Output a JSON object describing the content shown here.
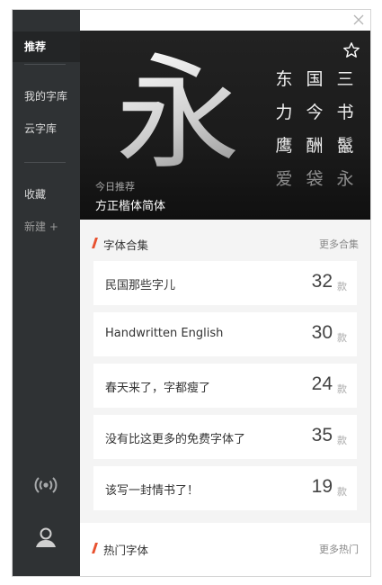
{
  "sidebar": {
    "items": [
      {
        "label": "推荐"
      },
      {
        "label": "我的字库"
      },
      {
        "label": "云字库"
      },
      {
        "label": "收藏"
      },
      {
        "label": "新建 +"
      }
    ],
    "icons": {
      "broadcast": "broadcast-icon",
      "user": "user-icon"
    }
  },
  "banner": {
    "big_glyph": "永",
    "chars": [
      "东",
      "国",
      "三",
      "力",
      "今",
      "书",
      "鹰",
      "酬",
      "鬣",
      "爱",
      "袋",
      "永"
    ],
    "today_label": "今日推荐",
    "font_name": "方正楷体简体"
  },
  "collections_section": {
    "title": "字体合集",
    "more": "更多合集",
    "items": [
      {
        "name": "民国那些字儿",
        "count": "32",
        "unit": "款"
      },
      {
        "name": "Handwritten English",
        "count": "30",
        "unit": "款"
      },
      {
        "name": "春天来了，字都瘦了",
        "count": "24",
        "unit": "款"
      },
      {
        "name": "没有比这更多的免费字体了",
        "count": "35",
        "unit": "款"
      },
      {
        "name": "该写一封情书了！",
        "count": "19",
        "unit": "款"
      }
    ]
  },
  "hot_section": {
    "title": "热门字体",
    "more": "更多热门"
  },
  "colors": {
    "accent": "#e8512f",
    "sidebar": "#2f3234",
    "sidebar_active": "#232526"
  }
}
